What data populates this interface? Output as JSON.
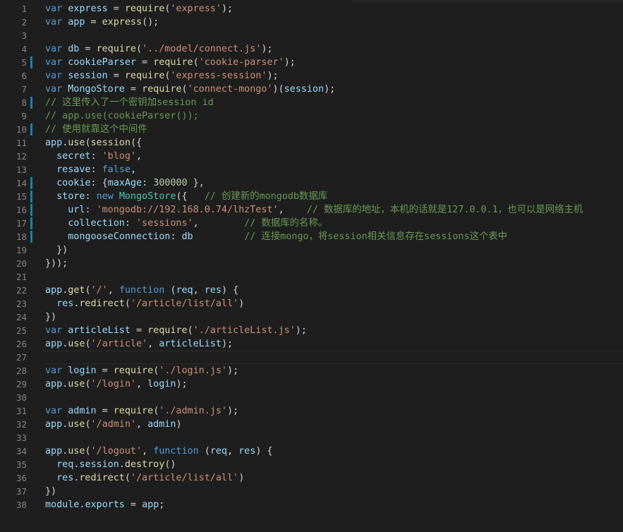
{
  "editor": {
    "active_line": 27,
    "modified_lines": [
      5,
      8,
      10,
      14,
      15,
      16,
      17,
      18
    ],
    "colors": {
      "background": "#1e1e1e",
      "keyword": "#569cd6",
      "identifier": "#9cdcfe",
      "function": "#dcdcaa",
      "string": "#ce9178",
      "number": "#b5cea8",
      "comment": "#6a9955",
      "class": "#4ec9b0",
      "line_number": "#858585",
      "gutter_marker": "#1b81a8"
    },
    "lines": [
      {
        "n": "1",
        "tokens": [
          [
            "kw",
            "var"
          ],
          [
            "p",
            " "
          ],
          [
            "id",
            "express"
          ],
          [
            "p",
            " = "
          ],
          [
            "fn",
            "require"
          ],
          [
            "p",
            "("
          ],
          [
            "str",
            "'express'"
          ],
          [
            "p",
            ");"
          ]
        ]
      },
      {
        "n": "2",
        "tokens": [
          [
            "kw",
            "var"
          ],
          [
            "p",
            " "
          ],
          [
            "id",
            "app"
          ],
          [
            "p",
            " = "
          ],
          [
            "fn",
            "express"
          ],
          [
            "p",
            "();"
          ]
        ]
      },
      {
        "n": "3",
        "tokens": []
      },
      {
        "n": "4",
        "tokens": [
          [
            "kw",
            "var"
          ],
          [
            "p",
            " "
          ],
          [
            "id",
            "db"
          ],
          [
            "p",
            " = "
          ],
          [
            "fn",
            "require"
          ],
          [
            "p",
            "("
          ],
          [
            "str",
            "'../model/connect.js'"
          ],
          [
            "p",
            ");"
          ]
        ]
      },
      {
        "n": "5",
        "tokens": [
          [
            "kw",
            "var"
          ],
          [
            "p",
            " "
          ],
          [
            "id",
            "cookieParser"
          ],
          [
            "p",
            " = "
          ],
          [
            "fn",
            "require"
          ],
          [
            "p",
            "("
          ],
          [
            "str",
            "'cookie-parser'"
          ],
          [
            "p",
            ");"
          ]
        ]
      },
      {
        "n": "6",
        "tokens": [
          [
            "kw",
            "var"
          ],
          [
            "p",
            " "
          ],
          [
            "id",
            "session"
          ],
          [
            "p",
            " = "
          ],
          [
            "fn",
            "require"
          ],
          [
            "p",
            "("
          ],
          [
            "str",
            "'express-session'"
          ],
          [
            "p",
            ");"
          ]
        ]
      },
      {
        "n": "7",
        "tokens": [
          [
            "kw",
            "var"
          ],
          [
            "p",
            " "
          ],
          [
            "id",
            "MongoStore"
          ],
          [
            "p",
            " = "
          ],
          [
            "fn",
            "require"
          ],
          [
            "p",
            "("
          ],
          [
            "str",
            "'connect-mongo'"
          ],
          [
            "p",
            ")("
          ],
          [
            "id",
            "session"
          ],
          [
            "p",
            ");"
          ]
        ]
      },
      {
        "n": "8",
        "tokens": [
          [
            "cm",
            "// 这里传入了一个密钥加session id"
          ]
        ]
      },
      {
        "n": "9",
        "tokens": [
          [
            "cm",
            "// app.use(cookieParser());"
          ]
        ]
      },
      {
        "n": "10",
        "tokens": [
          [
            "cm",
            "// 使用就靠这个中间件"
          ]
        ]
      },
      {
        "n": "11",
        "tokens": [
          [
            "id",
            "app"
          ],
          [
            "p",
            "."
          ],
          [
            "fn",
            "use"
          ],
          [
            "p",
            "("
          ],
          [
            "fn",
            "session"
          ],
          [
            "p",
            "({"
          ]
        ]
      },
      {
        "n": "12",
        "tokens": [
          [
            "p",
            "  "
          ],
          [
            "id",
            "secret"
          ],
          [
            "p",
            ": "
          ],
          [
            "str",
            "'blog'"
          ],
          [
            "p",
            ","
          ]
        ]
      },
      {
        "n": "13",
        "tokens": [
          [
            "p",
            "  "
          ],
          [
            "id",
            "resave"
          ],
          [
            "p",
            ": "
          ],
          [
            "kw",
            "false"
          ],
          [
            "p",
            ","
          ]
        ]
      },
      {
        "n": "14",
        "tokens": [
          [
            "p",
            "  "
          ],
          [
            "id",
            "cookie"
          ],
          [
            "p",
            ": {"
          ],
          [
            "id",
            "maxAge"
          ],
          [
            "p",
            ": "
          ],
          [
            "num",
            "300000"
          ],
          [
            "p",
            " },"
          ]
        ]
      },
      {
        "n": "15",
        "tokens": [
          [
            "p",
            "  "
          ],
          [
            "id",
            "store"
          ],
          [
            "p",
            ": "
          ],
          [
            "kw",
            "new"
          ],
          [
            "p",
            " "
          ],
          [
            "cls",
            "MongoStore"
          ],
          [
            "p",
            "({   "
          ],
          [
            "cm",
            "// 创建新的mongodb数据库"
          ]
        ]
      },
      {
        "n": "16",
        "tokens": [
          [
            "p",
            "    "
          ],
          [
            "id",
            "url"
          ],
          [
            "p",
            ": "
          ],
          [
            "str",
            "'mongodb://192.168.0.74/lhzTest'"
          ],
          [
            "p",
            ",    "
          ],
          [
            "cm",
            "// 数据库的地址，本机的话就是127.0.0.1，也可以是网络主机"
          ]
        ]
      },
      {
        "n": "17",
        "tokens": [
          [
            "p",
            "    "
          ],
          [
            "id",
            "collection"
          ],
          [
            "p",
            ": "
          ],
          [
            "str",
            "'sessions'"
          ],
          [
            "p",
            ",        "
          ],
          [
            "cm",
            "// 数据库的名称。"
          ]
        ]
      },
      {
        "n": "18",
        "tokens": [
          [
            "p",
            "    "
          ],
          [
            "id",
            "mongooseConnection"
          ],
          [
            "p",
            ": "
          ],
          [
            "id",
            "db"
          ],
          [
            "p",
            "         "
          ],
          [
            "cm",
            "// 连接mongo，将session相关信息存在sessions这个表中"
          ]
        ]
      },
      {
        "n": "19",
        "tokens": [
          [
            "p",
            "  })"
          ]
        ]
      },
      {
        "n": "20",
        "tokens": [
          [
            "p",
            "}));"
          ]
        ]
      },
      {
        "n": "21",
        "tokens": []
      },
      {
        "n": "22",
        "tokens": [
          [
            "id",
            "app"
          ],
          [
            "p",
            "."
          ],
          [
            "fn",
            "get"
          ],
          [
            "p",
            "("
          ],
          [
            "str",
            "'/'"
          ],
          [
            "p",
            ", "
          ],
          [
            "kw",
            "function"
          ],
          [
            "p",
            " ("
          ],
          [
            "id",
            "req"
          ],
          [
            "p",
            ", "
          ],
          [
            "id",
            "res"
          ],
          [
            "p",
            ") {"
          ]
        ]
      },
      {
        "n": "23",
        "tokens": [
          [
            "p",
            "  "
          ],
          [
            "id",
            "res"
          ],
          [
            "p",
            "."
          ],
          [
            "fn",
            "redirect"
          ],
          [
            "p",
            "("
          ],
          [
            "str",
            "'/article/list/all'"
          ],
          [
            "p",
            ")"
          ]
        ]
      },
      {
        "n": "24",
        "tokens": [
          [
            "p",
            "})"
          ]
        ]
      },
      {
        "n": "25",
        "tokens": [
          [
            "kw",
            "var"
          ],
          [
            "p",
            " "
          ],
          [
            "id",
            "articleList"
          ],
          [
            "p",
            " = "
          ],
          [
            "fn",
            "require"
          ],
          [
            "p",
            "("
          ],
          [
            "str",
            "'./articleList.js'"
          ],
          [
            "p",
            ");"
          ]
        ]
      },
      {
        "n": "26",
        "tokens": [
          [
            "id",
            "app"
          ],
          [
            "p",
            "."
          ],
          [
            "fn",
            "use"
          ],
          [
            "p",
            "("
          ],
          [
            "str",
            "'/article'"
          ],
          [
            "p",
            ", "
          ],
          [
            "id",
            "articleList"
          ],
          [
            "p",
            ");"
          ]
        ]
      },
      {
        "n": "27",
        "tokens": []
      },
      {
        "n": "28",
        "tokens": [
          [
            "kw",
            "var"
          ],
          [
            "p",
            " "
          ],
          [
            "id",
            "login"
          ],
          [
            "p",
            " = "
          ],
          [
            "fn",
            "require"
          ],
          [
            "p",
            "("
          ],
          [
            "str",
            "'./login.js'"
          ],
          [
            "p",
            ");"
          ]
        ]
      },
      {
        "n": "29",
        "tokens": [
          [
            "id",
            "app"
          ],
          [
            "p",
            "."
          ],
          [
            "fn",
            "use"
          ],
          [
            "p",
            "("
          ],
          [
            "str",
            "'/login'"
          ],
          [
            "p",
            ", "
          ],
          [
            "id",
            "login"
          ],
          [
            "p",
            ");"
          ]
        ]
      },
      {
        "n": "30",
        "tokens": []
      },
      {
        "n": "31",
        "tokens": [
          [
            "kw",
            "var"
          ],
          [
            "p",
            " "
          ],
          [
            "id",
            "admin"
          ],
          [
            "p",
            " = "
          ],
          [
            "fn",
            "require"
          ],
          [
            "p",
            "("
          ],
          [
            "str",
            "'./admin.js'"
          ],
          [
            "p",
            ");"
          ]
        ]
      },
      {
        "n": "32",
        "tokens": [
          [
            "id",
            "app"
          ],
          [
            "p",
            "."
          ],
          [
            "fn",
            "use"
          ],
          [
            "p",
            "("
          ],
          [
            "str",
            "'/admin'"
          ],
          [
            "p",
            ", "
          ],
          [
            "id",
            "admin"
          ],
          [
            "p",
            ")"
          ]
        ]
      },
      {
        "n": "33",
        "tokens": []
      },
      {
        "n": "34",
        "tokens": [
          [
            "id",
            "app"
          ],
          [
            "p",
            "."
          ],
          [
            "fn",
            "use"
          ],
          [
            "p",
            "("
          ],
          [
            "str",
            "'/logout'"
          ],
          [
            "p",
            ", "
          ],
          [
            "kw",
            "function"
          ],
          [
            "p",
            " ("
          ],
          [
            "id",
            "req"
          ],
          [
            "p",
            ", "
          ],
          [
            "id",
            "res"
          ],
          [
            "p",
            ") {"
          ]
        ]
      },
      {
        "n": "35",
        "tokens": [
          [
            "p",
            "  "
          ],
          [
            "id",
            "req"
          ],
          [
            "p",
            "."
          ],
          [
            "id",
            "session"
          ],
          [
            "p",
            "."
          ],
          [
            "fn",
            "destroy"
          ],
          [
            "p",
            "()"
          ]
        ]
      },
      {
        "n": "36",
        "tokens": [
          [
            "p",
            "  "
          ],
          [
            "id",
            "res"
          ],
          [
            "p",
            "."
          ],
          [
            "fn",
            "redirect"
          ],
          [
            "p",
            "("
          ],
          [
            "str",
            "'/article/list/all'"
          ],
          [
            "p",
            ")"
          ]
        ]
      },
      {
        "n": "37",
        "tokens": [
          [
            "p",
            "})"
          ]
        ]
      },
      {
        "n": "38",
        "tokens": [
          [
            "id",
            "module"
          ],
          [
            "p",
            "."
          ],
          [
            "id",
            "exports"
          ],
          [
            "p",
            " = "
          ],
          [
            "id",
            "app"
          ],
          [
            "p",
            ";"
          ]
        ]
      }
    ]
  }
}
